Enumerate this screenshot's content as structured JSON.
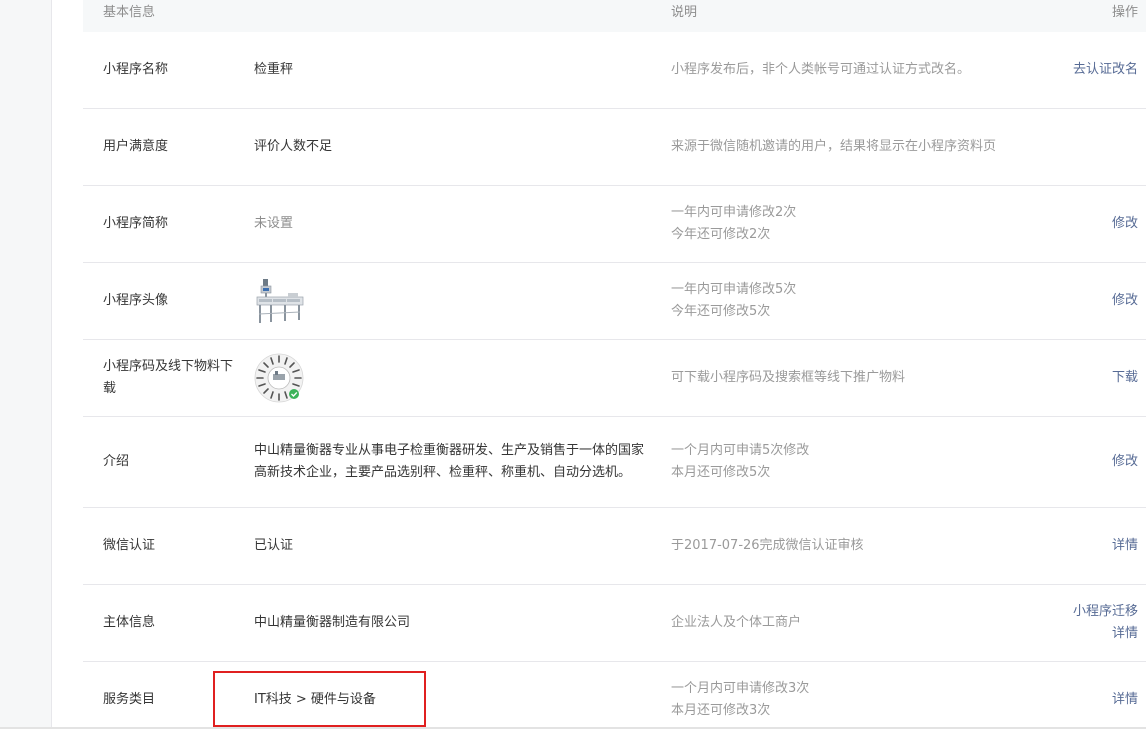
{
  "header": {
    "basic_info": "基本信息",
    "description": "说明",
    "operation": "操作"
  },
  "rows": {
    "name": {
      "label": "小程序名称",
      "value": "检重秤",
      "desc": "小程序发布后，非个人类帐号可通过认证方式改名。",
      "action": "去认证改名"
    },
    "satisfaction": {
      "label": "用户满意度",
      "value": "评价人数不足",
      "desc": "来源于微信随机邀请的用户，结果将显示在小程序资料页"
    },
    "short_name": {
      "label": "小程序简称",
      "value": "未设置",
      "desc_line1": "一年内可申请修改2次",
      "desc_line2": "今年还可修改2次",
      "action": "修改"
    },
    "avatar": {
      "label": "小程序头像",
      "desc_line1": "一年内可申请修改5次",
      "desc_line2": "今年还可修改5次",
      "action": "修改",
      "icon": "checkweigher-machine-image"
    },
    "qrcode": {
      "label": "小程序码及线下物料下载",
      "desc": "可下载小程序码及搜索框等线下推广物料",
      "action": "下载",
      "icon": "mini-program-code-image"
    },
    "intro": {
      "label": "介绍",
      "value": "中山精量衡器专业从事电子检重衡器研发、生产及销售于一体的国家高新技术企业，主要产品选别秤、检重秤、称重机、自动分选机。",
      "desc_line1": "一个月内可申请5次修改",
      "desc_line2": "本月还可修改5次",
      "action": "修改"
    },
    "wechat_verify": {
      "label": "微信认证",
      "value": "已认证",
      "desc": "于2017-07-26完成微信认证审核",
      "action": "详情"
    },
    "entity": {
      "label": "主体信息",
      "value": "中山精量衡器制造有限公司",
      "desc": "企业法人及个体工商户",
      "action1": "小程序迁移",
      "action2": "详情"
    },
    "category": {
      "label": "服务类目",
      "value": "IT科技 > 硬件与设备",
      "desc_line1": "一个月内可申请修改3次",
      "desc_line2": "本月还可修改3次",
      "action": "详情"
    }
  },
  "colors": {
    "link": "#576b95",
    "muted": "#9a9a9a",
    "highlight": "#e02020",
    "header_bg": "#f6f8f9"
  }
}
